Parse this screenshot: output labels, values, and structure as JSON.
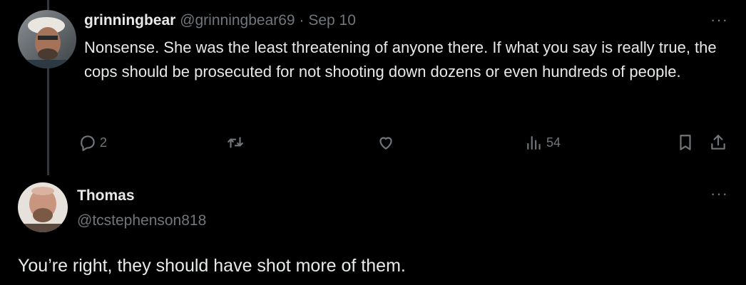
{
  "reply": {
    "author_name": "grinningbear",
    "author_handle": "@grinningbear69",
    "separator": "·",
    "date": "Sep 10",
    "more": "···",
    "text": "Nonsense. She was the least threatening of anyone there. If what you say is really true, the cops should be prosecuted for not shooting down dozens or even hundreds of people.",
    "actions": {
      "reply_count": "2",
      "retweet_count": "",
      "like_count": "",
      "views_count": "54"
    }
  },
  "post": {
    "author_name": "Thomas",
    "author_handle": "@tcstephenson818",
    "more": "···",
    "text": "You’re right, they should have shot more of them."
  },
  "icons": {
    "reply": "reply-bubble-icon",
    "retweet": "retweet-icon",
    "like": "heart-icon",
    "views": "views-bars-icon",
    "bookmark": "bookmark-icon",
    "share": "share-icon",
    "more": "more-horizontal-icon"
  },
  "colors": {
    "background": "#000000",
    "primary_text": "#e7e9ea",
    "secondary_text": "#71767b",
    "thread_line": "#333639"
  }
}
